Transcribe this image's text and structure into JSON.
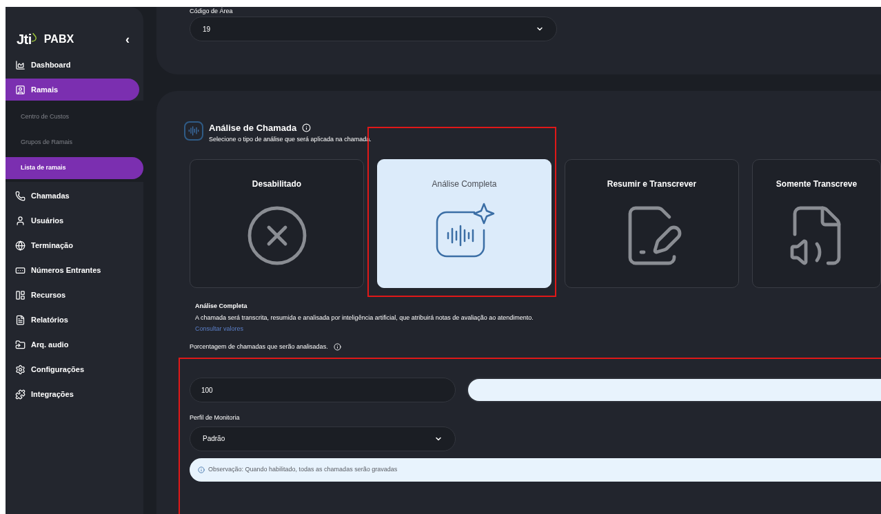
{
  "sidebar": {
    "logo": "Jti",
    "product": "PABX",
    "collapse": "‹",
    "items": [
      {
        "label": "Dashboard",
        "selected": false
      },
      {
        "label": "Ramais",
        "selected": true,
        "expanded": true,
        "children": [
          {
            "label": "Centro de Custos",
            "selected": false
          },
          {
            "label": "Grupos de Ramais",
            "selected": false
          },
          {
            "label": "Lista de ramais",
            "selected": true
          }
        ]
      },
      {
        "label": "Chamadas",
        "selected": false
      },
      {
        "label": "Usuários",
        "selected": false
      },
      {
        "label": "Terminação",
        "selected": false
      },
      {
        "label": "Números Entrantes",
        "selected": false
      },
      {
        "label": "Recursos",
        "selected": false
      },
      {
        "label": "Relatórios",
        "selected": false
      },
      {
        "label": "Arq. audio",
        "selected": false
      },
      {
        "label": "Configurações",
        "selected": false
      },
      {
        "label": "Integrações",
        "selected": false
      }
    ]
  },
  "area_code": {
    "label": "Código de Área",
    "value": "19"
  },
  "analysis": {
    "title": "Análise de Chamada",
    "subtitle": "Selecione o tipo de análise que será aplicada na chamada.",
    "options": [
      {
        "label": "Desabilitado",
        "selected": false
      },
      {
        "label": "Análise Completa",
        "selected": true
      },
      {
        "label": "Resumir e Transcrever",
        "selected": false
      },
      {
        "label": "Somente Transcreve",
        "selected": false
      }
    ],
    "detail_title": "Análise Completa",
    "detail_text": "A chamada será transcrita, resumida e analisada por inteligência artificial, que atribuirá notas de avaliação ao atendimento.",
    "link": "Consultar valores",
    "percent_label": "Porcentagem de chamadas que serão analisadas.",
    "percent_value": "100",
    "percent_slider": {
      "level": 1
    },
    "profile_label": "Perfil de Monitoria",
    "profile_value": "Padrão",
    "note": "Observação: Quando habilitado, todas as chamadas serão gravadas"
  }
}
